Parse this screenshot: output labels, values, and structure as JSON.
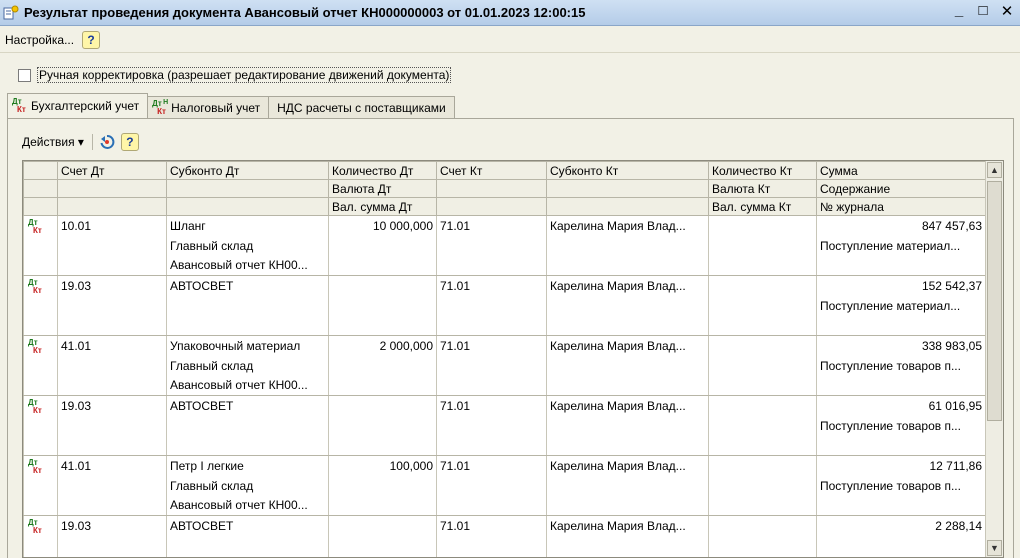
{
  "window": {
    "title": "Результат проведения документа Авансовый отчет КН000000003 от 01.01.2023 12:00:15",
    "controls": {
      "minimize": "_",
      "maximize": "□",
      "close": "✕"
    }
  },
  "menu": {
    "settings_label": "Настройка...",
    "help_label": "?"
  },
  "manual_edit": {
    "checked": false,
    "label": "Ручная корректировка (разрешает редактирование движений документа)"
  },
  "tabs": [
    {
      "label": "Бухгалтерский учет",
      "icon": "dt-kt-icon",
      "active": true
    },
    {
      "label": "Налоговый учет",
      "icon": "dt-kt-tax-icon",
      "active": false
    },
    {
      "label": "НДС расчеты с поставщиками",
      "icon": "",
      "active": false
    }
  ],
  "toolbar": {
    "actions_label": "Действия",
    "actions_arrow": "▾",
    "help_label": "?"
  },
  "icon_glyphs": {
    "dt": "Дт",
    "kt": "Кт",
    "h": "Н"
  },
  "grid": {
    "header_rows": [
      [
        "",
        "Счет Дт",
        "Субконто Дт",
        "Количество Дт",
        "Счет Кт",
        "Субконто Кт",
        "Количество Кт",
        "Сумма"
      ],
      [
        "",
        "",
        "",
        "Валюта Дт",
        "",
        "",
        "Валюта Кт",
        "Содержание"
      ],
      [
        "",
        "",
        "",
        "Вал. сумма Дт",
        "",
        "",
        "Вал. сумма Кт",
        "№ журнала"
      ]
    ],
    "records": [
      {
        "acct_dt": "10.01",
        "sub_dt": [
          "Шланг",
          "Главный склад",
          "Авансовый отчет КН00..."
        ],
        "qty_dt": "10 000,000",
        "acct_kt": "71.01",
        "sub_kt": "Карелина Мария Влад...",
        "qty_kt": "",
        "sum": "847 457,63",
        "content": "Поступление материал..."
      },
      {
        "acct_dt": "19.03",
        "sub_dt": [
          "АВТОСВЕТ",
          "",
          ""
        ],
        "qty_dt": "",
        "acct_kt": "71.01",
        "sub_kt": "Карелина Мария Влад...",
        "qty_kt": "",
        "sum": "152 542,37",
        "content": "Поступление материал..."
      },
      {
        "acct_dt": "41.01",
        "sub_dt": [
          "Упаковочный материал",
          "Главный склад",
          "Авансовый отчет КН00..."
        ],
        "qty_dt": "2 000,000",
        "acct_kt": "71.01",
        "sub_kt": "Карелина Мария Влад...",
        "qty_kt": "",
        "sum": "338 983,05",
        "content": "Поступление товаров п..."
      },
      {
        "acct_dt": "19.03",
        "sub_dt": [
          "АВТОСВЕТ",
          "",
          ""
        ],
        "qty_dt": "",
        "acct_kt": "71.01",
        "sub_kt": "Карелина Мария Влад...",
        "qty_kt": "",
        "sum": "61 016,95",
        "content": "Поступление товаров п..."
      },
      {
        "acct_dt": "41.01",
        "sub_dt": [
          "Петр I легкие",
          "Главный склад",
          "Авансовый отчет КН00..."
        ],
        "qty_dt": "100,000",
        "acct_kt": "71.01",
        "sub_kt": "Карелина Мария Влад...",
        "qty_kt": "",
        "sum": "12 711,86",
        "content": "Поступление товаров п..."
      },
      {
        "acct_dt": "19.03",
        "sub_dt": [
          "АВТОСВЕТ",
          "",
          ""
        ],
        "qty_dt": "",
        "acct_kt": "71.01",
        "sub_kt": "Карелина Мария Влад...",
        "qty_kt": "",
        "sum": "2 288,14",
        "content": ""
      }
    ]
  },
  "colors": {
    "dt": "#1d7a1d",
    "kt": "#c41c1c",
    "titlebar": "#c4d8ef",
    "panel": "#f2f1e6"
  }
}
